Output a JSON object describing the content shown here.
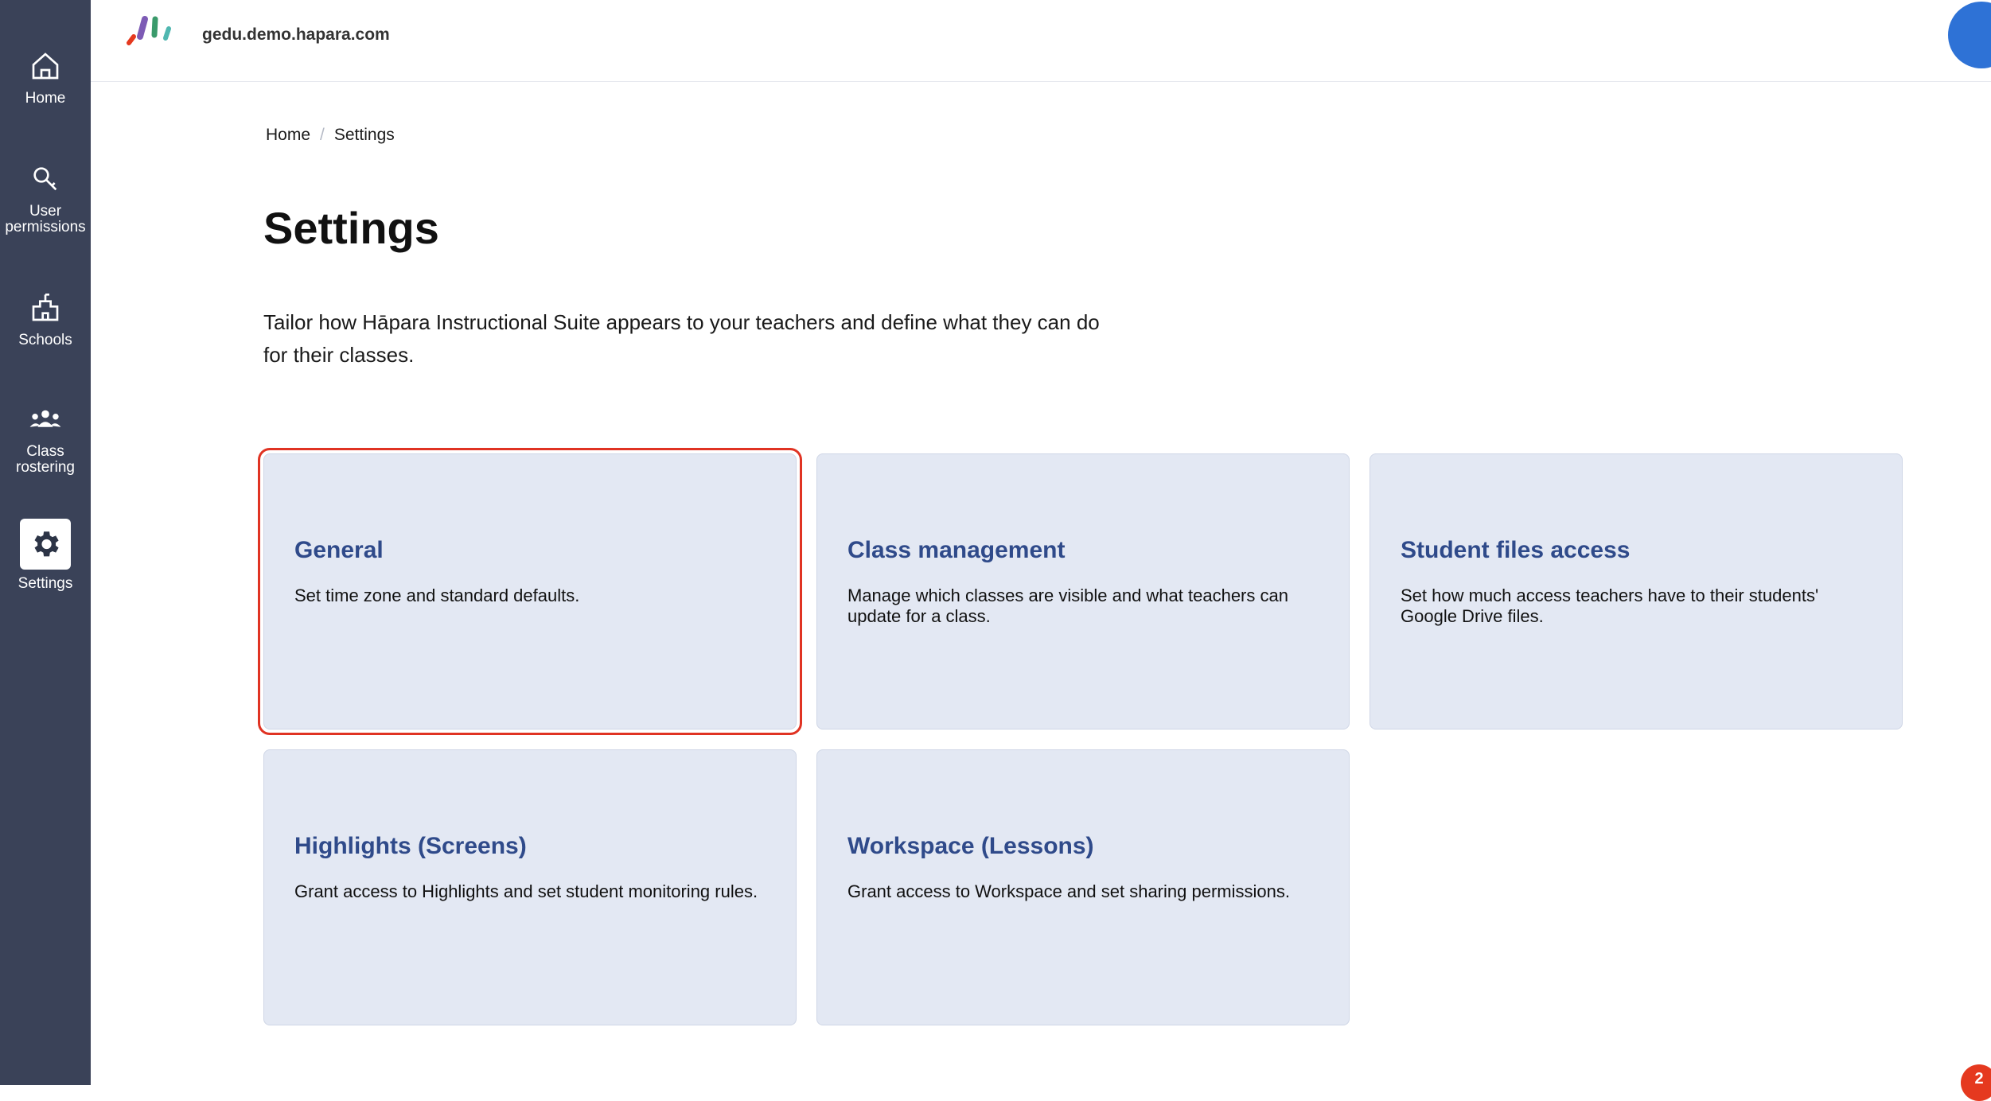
{
  "header": {
    "domain": "gedu.demo.hapara.com"
  },
  "sidebar": {
    "items": [
      {
        "label": "Home",
        "icon": "home-icon"
      },
      {
        "label": "User permissions",
        "icon": "key-icon"
      },
      {
        "label": "Schools",
        "icon": "school-icon"
      },
      {
        "label": "Class rostering",
        "icon": "people-icon"
      },
      {
        "label": "Settings",
        "icon": "gear-icon",
        "active": true
      }
    ]
  },
  "breadcrumb": {
    "home": "Home",
    "separator": "/",
    "current": "Settings"
  },
  "page": {
    "title": "Settings",
    "intro": "Tailor how Hāpara Instructional Suite appears to your teachers and define what they can do for their classes."
  },
  "cards": [
    {
      "title": "General",
      "description": "Set time zone and standard defaults."
    },
    {
      "title": "Class management",
      "description": "Manage which classes are visible and what teachers can update for a class."
    },
    {
      "title": "Student files access",
      "description": "Set how much access teachers have to their students' Google Drive files."
    },
    {
      "title": "Highlights (Screens)",
      "description": "Grant access to Highlights and set student monitoring rules."
    },
    {
      "title": "Workspace (Lessons)",
      "description": "Grant access to Workspace and set sharing permissions."
    }
  ],
  "notification_badge": {
    "count": "2"
  },
  "colors": {
    "sidebar": "#3a4258",
    "card": "#e3e8f3",
    "card_title": "#2f4a8a",
    "selection": "#e03323",
    "avatar": "#2e72d6"
  }
}
